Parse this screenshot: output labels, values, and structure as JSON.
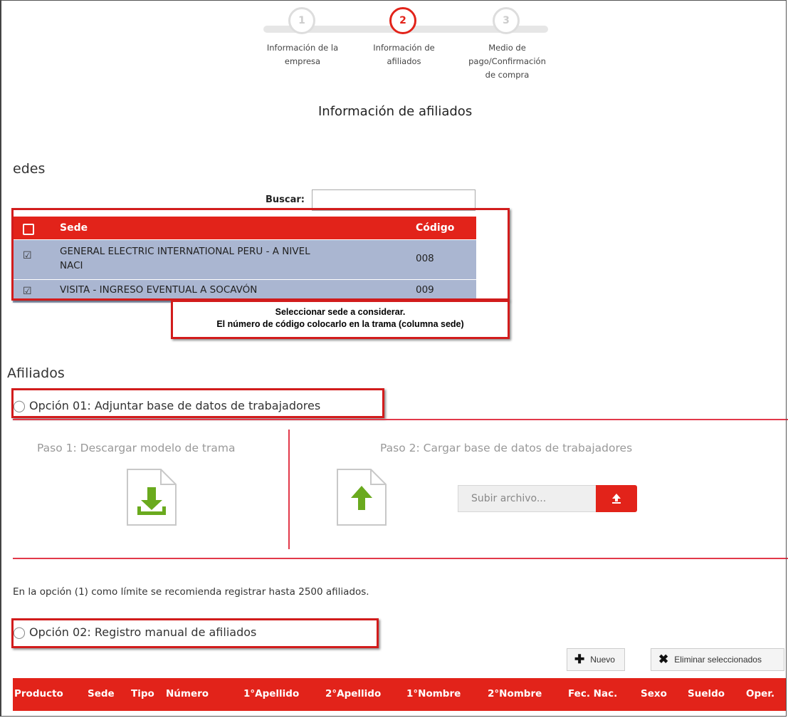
{
  "stepper": {
    "steps": [
      {
        "number": "1",
        "label_line1": "Información de la",
        "label_line2": "empresa",
        "label_line3": ""
      },
      {
        "number": "2",
        "label_line1": "Información de",
        "label_line2": "afiliados",
        "label_line3": ""
      },
      {
        "number": "3",
        "label_line1": "Medio de",
        "label_line2": "pago/Confirmación",
        "label_line3": "de compra"
      }
    ],
    "active_step": 2
  },
  "page_title": "Información de afiliados",
  "sedes": {
    "heading": "edes",
    "search_label": "Buscar:",
    "search_value": "",
    "columns": {
      "sede": "Sede",
      "codigo": "Código"
    },
    "rows": [
      {
        "sede_line1": "GENERAL ELECTRIC INTERNATIONAL PERU - A NIVEL",
        "sede_line2": "NACI",
        "codigo": "008",
        "checked": true
      },
      {
        "sede_line1": "VISITA - INGRESO EVENTUAL A SOCAVÓN",
        "sede_line2": "",
        "codigo": "009",
        "checked": true
      }
    ],
    "callout_line1": "Seleccionar sede a considerar.",
    "callout_line2": "El número de código colocarlo en la trama (columna sede)"
  },
  "afiliados": {
    "heading": "Afiliados",
    "option1": {
      "label": "Opción 01: Adjuntar base de datos de trabajadores",
      "paso1": "Paso 1: Descargar modelo de trama",
      "paso2": "Paso 2: Cargar base de datos de trabajadores",
      "upload_placeholder": "Subir archivo..."
    },
    "note": "En la opción (1) como límite se recomienda registrar hasta 2500 afiliados.",
    "option2": {
      "label": "Opción 02: Registro manual de afiliados",
      "nuevo_label": "Nuevo",
      "eliminar_label": "Eliminar seleccionados"
    },
    "grid_columns": [
      "Producto",
      "Sede",
      "Tipo",
      "Número",
      "1°Apellido",
      "2°Apellido",
      "1°Nombre",
      "2°Nombre",
      "Fec. Nac.",
      "Sexo",
      "Sueldo",
      "Oper."
    ]
  },
  "colors": {
    "accent": "#e2231a",
    "row_selected": "#aab6d1",
    "icon_green": "#6aaa1e"
  },
  "icons": [
    "download-file-icon",
    "upload-file-icon",
    "upload-arrow-icon",
    "plus-icon",
    "times-icon",
    "checkbox-icon"
  ]
}
